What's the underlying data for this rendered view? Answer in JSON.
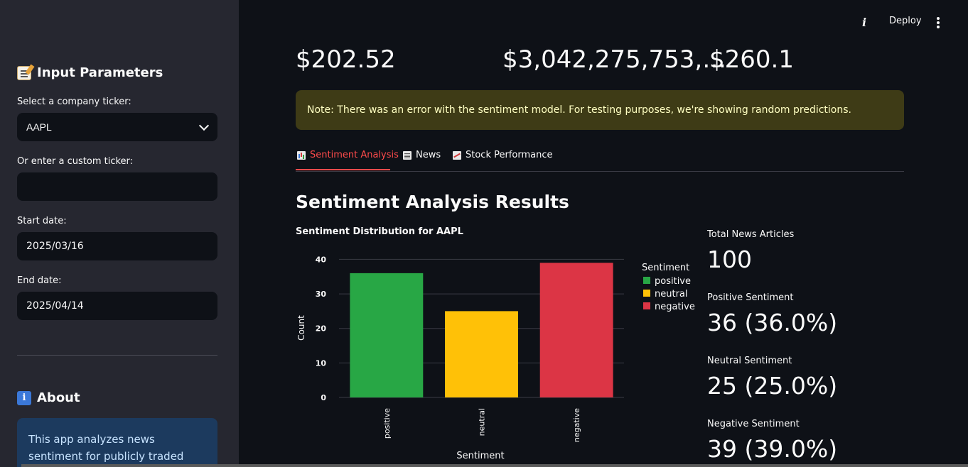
{
  "header": {
    "deploy_label": "Deploy"
  },
  "sidebar": {
    "input_title": "Input Parameters",
    "ticker_label": "Select a company ticker:",
    "ticker_value": "AAPL",
    "custom_ticker_label": "Or enter a custom ticker:",
    "custom_ticker_value": "",
    "start_label": "Start date:",
    "start_value": "2025/03/16",
    "end_label": "End date:",
    "end_value": "2025/04/14",
    "about_title": "About",
    "about_text": "This app analyzes news sentiment for publicly traded companies and"
  },
  "metrics": [
    {
      "value": "$202.52"
    },
    {
      "value": "$3,042,275,753,…"
    },
    {
      "value": "$260.1"
    }
  ],
  "warning": "Note: There was an error with the sentiment model. For testing purposes, we're showing random predictions.",
  "tabs": [
    {
      "label": "Sentiment Analysis",
      "icon": "bar-chart-icon",
      "active": true
    },
    {
      "label": "News",
      "icon": "newspaper-icon",
      "active": false
    },
    {
      "label": "Stock Performance",
      "icon": "line-chart-icon",
      "active": false
    }
  ],
  "section_title": "Sentiment Analysis Results",
  "chart_data": {
    "type": "bar",
    "title": "Sentiment Distribution for AAPL",
    "categories": [
      "positive",
      "neutral",
      "negative"
    ],
    "values": [
      36,
      25,
      39
    ],
    "colors": [
      "#28a745",
      "#ffc107",
      "#dc3545"
    ],
    "xlabel": "Sentiment",
    "ylabel": "Count",
    "ylim": [
      0,
      40
    ],
    "yticks": [
      0,
      10,
      20,
      30,
      40
    ],
    "legend_title": "Sentiment",
    "legend_position": "right",
    "grid": true
  },
  "stats": {
    "total_label": "Total News Articles",
    "total_value": "100",
    "positive_label": "Positive Sentiment",
    "positive_value": "36 (36.0%)",
    "neutral_label": "Neutral Sentiment",
    "neutral_value": "25 (25.0%)",
    "negative_label": "Negative Sentiment",
    "negative_value": "39 (39.0%)"
  }
}
